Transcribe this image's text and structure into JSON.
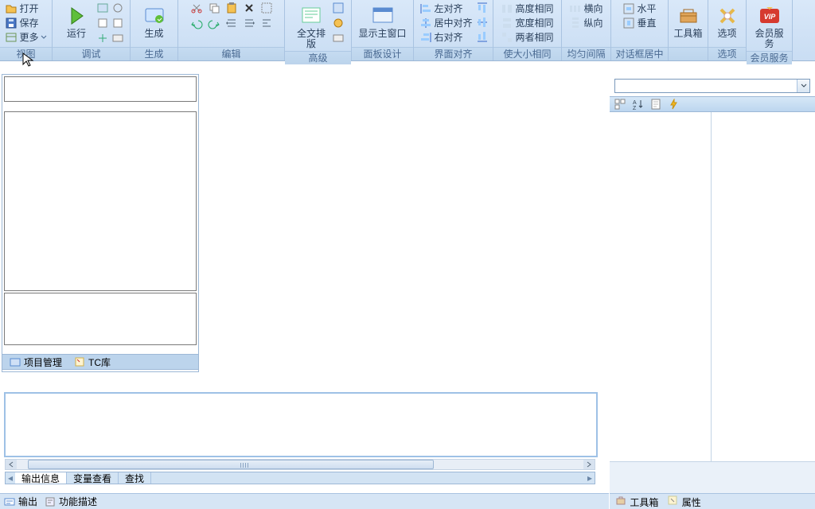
{
  "ribbon": {
    "groups": {
      "view": {
        "label": "视图",
        "open": "打开",
        "save": "保存",
        "more": "更多"
      },
      "debug": {
        "label": "调试",
        "run": "运行"
      },
      "generate": {
        "label": "生成",
        "btn": "生成"
      },
      "edit": {
        "label": "编辑"
      },
      "advanced": {
        "label": "高级",
        "full": "全文排版"
      },
      "panel": {
        "label": "面板设计",
        "btn": "显示主窗口"
      },
      "align": {
        "label": "界面对齐",
        "left": "左对齐",
        "center": "居中对齐",
        "right": "右对齐"
      },
      "samesize": {
        "label": "使大小相同",
        "h": "高度相同",
        "w": "宽度相同",
        "both": "两者相同"
      },
      "spacing": {
        "label": "均匀间隔",
        "horiz": "横向",
        "vert": "纵向"
      },
      "centerdlg": {
        "label": "对话框居中",
        "horiz": "水平",
        "vert": "垂直"
      },
      "toolbox": {
        "label": "",
        "btn": "工具箱"
      },
      "options": {
        "label": "选项",
        "btn": "选项"
      },
      "member": {
        "label": "会员服务",
        "btn": "会员服务"
      }
    }
  },
  "left_tabs": {
    "project": "项目管理",
    "tc": "TC库"
  },
  "output_tabs": {
    "output": "输出信息",
    "vars": "变量查看",
    "find": "查找"
  },
  "bottom": {
    "output": "输出",
    "funcdesc": "功能描述"
  },
  "right_tabs": {
    "toolbox": "工具箱",
    "props": "属性"
  }
}
